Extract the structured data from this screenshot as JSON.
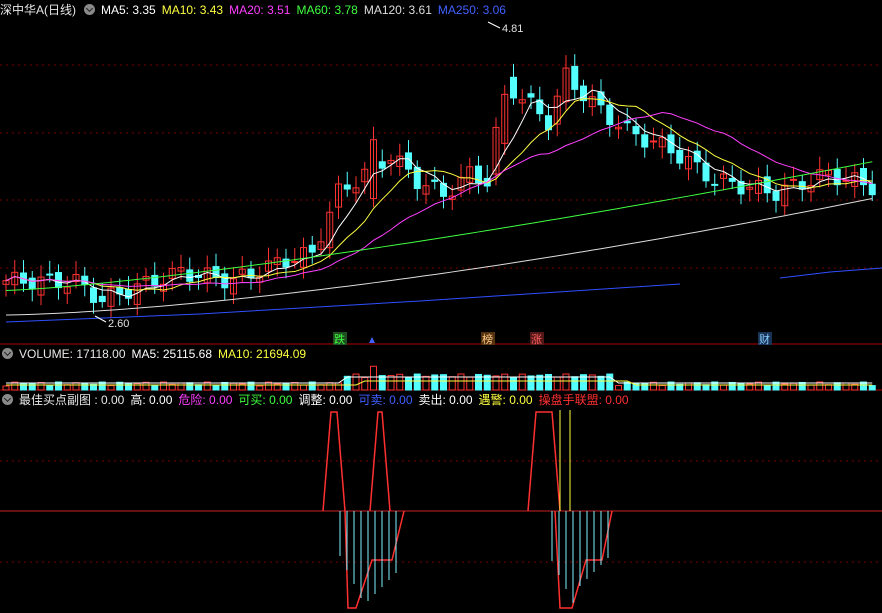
{
  "main": {
    "title": "深中华A(日线)",
    "indicators": [
      {
        "label": "MA5: 3.35",
        "color": "#ffffff"
      },
      {
        "label": "MA10: 3.43",
        "color": "#ffff40"
      },
      {
        "label": "MA20: 3.51",
        "color": "#ff40ff"
      },
      {
        "label": "MA60: 3.78",
        "color": "#40ff40"
      },
      {
        "label": "MA120: 3.61",
        "color": "#dddddd"
      },
      {
        "label": "MA250: 3.06",
        "color": "#4060ff"
      }
    ],
    "high_label": "4.81",
    "low_label": "2.60",
    "markers": [
      {
        "text": "跌",
        "color": "#40ff40",
        "bg": "#205020"
      },
      {
        "text": "榜",
        "color": "#ffcc88",
        "bg": "#553311"
      },
      {
        "text": "涨",
        "color": "#ff6060",
        "bg": "#551818"
      },
      {
        "text": "财",
        "color": "#88ccff",
        "bg": "#183355"
      }
    ]
  },
  "volume": {
    "label": "VOLUME: 17118.00",
    "ma5": "MA5: 25115.68",
    "ma10": "MA10: 21694.09"
  },
  "indicator_panel": {
    "title": "最佳买点副图 : 0.00",
    "items": [
      {
        "label": "高: 0.00",
        "color": "#ffffff"
      },
      {
        "label": "危险: 0.00",
        "color": "#ff40ff"
      },
      {
        "label": "可买: 0.00",
        "color": "#40ff40"
      },
      {
        "label": "调整: 0.00",
        "color": "#ffffff"
      },
      {
        "label": "可卖: 0.00",
        "color": "#4060ff"
      },
      {
        "label": "卖出: 0.00",
        "color": "#ffffff"
      },
      {
        "label": "遇警: 0.00",
        "color": "#ffff40"
      },
      {
        "label": "操盘手联盟: 0.00",
        "color": "#ff3030"
      }
    ]
  },
  "colors": {
    "up": "#ff3232",
    "down": "#54ffff",
    "grid": "#7a0000",
    "divider": "#b00000"
  }
}
